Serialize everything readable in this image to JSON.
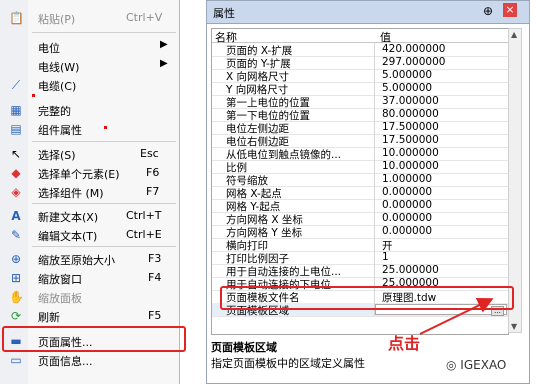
{
  "menu": {
    "items": [
      {
        "icon": "paste-icon",
        "glyph": "📋",
        "label": "粘贴(P)",
        "shortcut": "Ctrl+V",
        "disabled": true
      },
      {
        "icon": "",
        "label": "电位",
        "arrow": "▶"
      },
      {
        "icon": "",
        "label": "电线(W)",
        "arrow": "▶"
      },
      {
        "icon": "cable-icon",
        "glyph": "⟋",
        "label": "电缆(C)"
      },
      {
        "icon": "component-icon",
        "glyph": "▦",
        "label": "完整的"
      },
      {
        "icon": "component-props-icon",
        "glyph": "▤",
        "label": "组件属性"
      },
      {
        "icon": "pointer-icon",
        "glyph": "↖",
        "label": "选择(S)",
        "shortcut": "Esc"
      },
      {
        "icon": "select-element-icon",
        "glyph": "◆",
        "label": "选择单个元素(E)",
        "shortcut": "F6"
      },
      {
        "icon": "select-group-icon",
        "glyph": "◈",
        "label": "选择组件 (M)",
        "shortcut": "F7"
      },
      {
        "icon": "new-text-icon",
        "glyph": "A",
        "label": "新建文本(X)",
        "shortcut": "Ctrl+T"
      },
      {
        "icon": "edit-text-icon",
        "glyph": "✎",
        "label": "编辑文本(T)",
        "shortcut": "Ctrl+E"
      },
      {
        "icon": "zoom-reset-icon",
        "glyph": "⊕",
        "label": "缩放至原始大小",
        "shortcut": "F3"
      },
      {
        "icon": "zoom-window-icon",
        "glyph": "⊞",
        "label": "缩放窗口",
        "shortcut": "F4"
      },
      {
        "icon": "zoom-panel-icon",
        "glyph": "✋",
        "label": "缩放面板",
        "disabled": true
      },
      {
        "icon": "refresh-icon",
        "glyph": "⟳",
        "label": "刷新",
        "shortcut": "F5"
      },
      {
        "icon": "page-props-icon",
        "glyph": "▬",
        "label": "页面属性..."
      },
      {
        "icon": "page-info-icon",
        "glyph": "▭",
        "label": "页面信息..."
      }
    ]
  },
  "panel": {
    "title": "属性",
    "pin": "⊕",
    "close": "×",
    "header": {
      "name": "名称",
      "value": "值"
    },
    "rows": [
      {
        "name": "页面的 X-扩展",
        "value": "420.000000"
      },
      {
        "name": "页面的 Y-扩展",
        "value": "297.000000"
      },
      {
        "name": "X 向网格尺寸",
        "value": "5.000000"
      },
      {
        "name": "Y 向网格尺寸",
        "value": "5.000000"
      },
      {
        "name": "第一上电位的位置",
        "value": "37.000000"
      },
      {
        "name": "第一下电位的位置",
        "value": "80.000000"
      },
      {
        "name": "电位左侧边距",
        "value": "17.500000"
      },
      {
        "name": "电位右侧边距",
        "value": "17.500000"
      },
      {
        "name": "从低电位到触点镜像的...",
        "value": "10.000000"
      },
      {
        "name": "比例",
        "value": "10.000000"
      },
      {
        "name": "符号缩放",
        "value": "1.000000"
      },
      {
        "name": "网格 X-起点",
        "value": "0.000000"
      },
      {
        "name": "网格 Y-起点",
        "value": "0.000000"
      },
      {
        "name": "方向网格 X 坐标",
        "value": "0.000000"
      },
      {
        "name": "方向网格 Y 坐标",
        "value": "0.000000"
      },
      {
        "name": "横向打印",
        "value": "开"
      },
      {
        "name": "打印比例因子",
        "value": "1"
      },
      {
        "name": "用于自动连接的上电位...",
        "value": "25.000000"
      },
      {
        "name": "用于自动连接的下电位...",
        "value": "25.000000"
      },
      {
        "name": "页面模板文件名",
        "value": "原理图.tdw"
      },
      {
        "name": "页面模板区域",
        "value": "",
        "selected": true,
        "button": "..."
      }
    ],
    "desc_title": "页面模板区域",
    "desc_text": "指定页面模板中的区域定义属性"
  },
  "annotation": {
    "callout": "点击",
    "color": "#e02424"
  },
  "watermark": "IGEXAO"
}
